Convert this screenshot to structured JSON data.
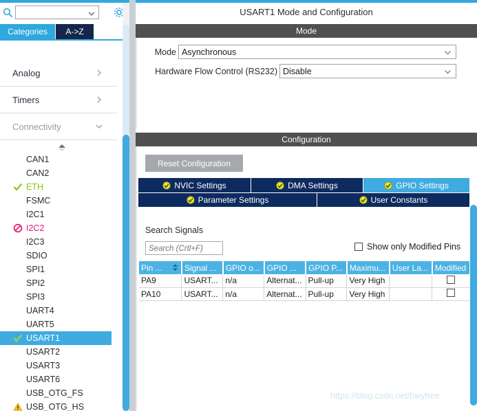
{
  "left_panel": {
    "search": {
      "value": "",
      "placeholder": "",
      "icon": "search-icon"
    },
    "gear_icon": "gear-icon",
    "tabs": [
      {
        "label": "Categories",
        "selected": false,
        "style": "light"
      },
      {
        "label": "A->Z",
        "selected": true,
        "style": "dark"
      }
    ],
    "groups": [
      {
        "label": "Analog",
        "expanded": false,
        "chevron": "chevron-right-icon",
        "muted": false
      },
      {
        "label": "Timers",
        "expanded": false,
        "chevron": "chevron-right-icon",
        "muted": false
      },
      {
        "label": "Connectivity",
        "expanded": true,
        "chevron": "chevron-down-icon",
        "muted": true
      }
    ],
    "scroll_up_icon": "scroll-up-arrow-icon",
    "items": [
      {
        "label": "CAN1",
        "status": "none",
        "selected": false
      },
      {
        "label": "CAN2",
        "status": "none",
        "selected": false
      },
      {
        "label": "ETH",
        "status": "check",
        "selected": false
      },
      {
        "label": "FSMC",
        "status": "none",
        "selected": false
      },
      {
        "label": "I2C1",
        "status": "none",
        "selected": false
      },
      {
        "label": "I2C2",
        "status": "blocked",
        "selected": false
      },
      {
        "label": "I2C3",
        "status": "none",
        "selected": false
      },
      {
        "label": "SDIO",
        "status": "none",
        "selected": false
      },
      {
        "label": "SPI1",
        "status": "none",
        "selected": false
      },
      {
        "label": "SPI2",
        "status": "none",
        "selected": false
      },
      {
        "label": "SPI3",
        "status": "none",
        "selected": false
      },
      {
        "label": "UART4",
        "status": "none",
        "selected": false
      },
      {
        "label": "UART5",
        "status": "none",
        "selected": false
      },
      {
        "label": "USART1",
        "status": "check",
        "selected": true
      },
      {
        "label": "USART2",
        "status": "none",
        "selected": false
      },
      {
        "label": "USART3",
        "status": "none",
        "selected": false
      },
      {
        "label": "USART6",
        "status": "none",
        "selected": false
      },
      {
        "label": "USB_OTG_FS",
        "status": "none",
        "selected": false
      },
      {
        "label": "USB_OTG_HS",
        "status": "warning",
        "selected": false
      }
    ]
  },
  "right_panel": {
    "title": "USART1 Mode and Configuration",
    "mode_section": {
      "header": "Mode",
      "rows": [
        {
          "label": "Mode",
          "value": "Asynchronous"
        },
        {
          "label": "Hardware Flow Control (RS232)",
          "value": "Disable"
        }
      ]
    },
    "config_section": {
      "header": "Configuration",
      "reset_button": "Reset Configuration",
      "tabs_row1": [
        {
          "label": "NVIC Settings",
          "selected": false
        },
        {
          "label": "DMA Settings",
          "selected": false
        },
        {
          "label": "GPIO Settings",
          "selected": true
        }
      ],
      "tabs_row2": [
        {
          "label": "Parameter Settings",
          "selected": false
        },
        {
          "label": "User Constants",
          "selected": false
        }
      ],
      "search_signals_label": "Search Signals",
      "search_signals_placeholder": "Search (Crtl+F)",
      "search_signals_value": "",
      "show_modified_label": "Show only Modified Pins",
      "show_modified_checked": false,
      "table": {
        "columns": [
          "Pin ...",
          "Signal ...",
          "GPIO o...",
          "GPIO ...",
          "GPIO P...",
          "Maximu...",
          "User La...",
          "Modified"
        ],
        "rows": [
          {
            "pin": "PA9",
            "signal": "USART...",
            "gpio_output": "n/a",
            "gpio_mode": "Alternat...",
            "gpio_pull": "Pull-up",
            "maximum": "Very High",
            "user_label": "",
            "modified": false
          },
          {
            "pin": "PA10",
            "signal": "USART...",
            "gpio_output": "n/a",
            "gpio_mode": "Alternat...",
            "gpio_pull": "Pull-up",
            "maximum": "Very High",
            "user_label": "",
            "modified": false
          }
        ]
      }
    }
  },
  "watermark": "https://blog.csdn.net/hwytree",
  "colors": {
    "accent_blue": "#3fabe0",
    "tab_navy": "#0d2b5e",
    "header_gray": "#505050",
    "check_green": "#8ec217",
    "blocked_pink": "#e3197f",
    "warning_yellow": "#f2c12e",
    "table_header_blue": "#4cb2e3"
  }
}
